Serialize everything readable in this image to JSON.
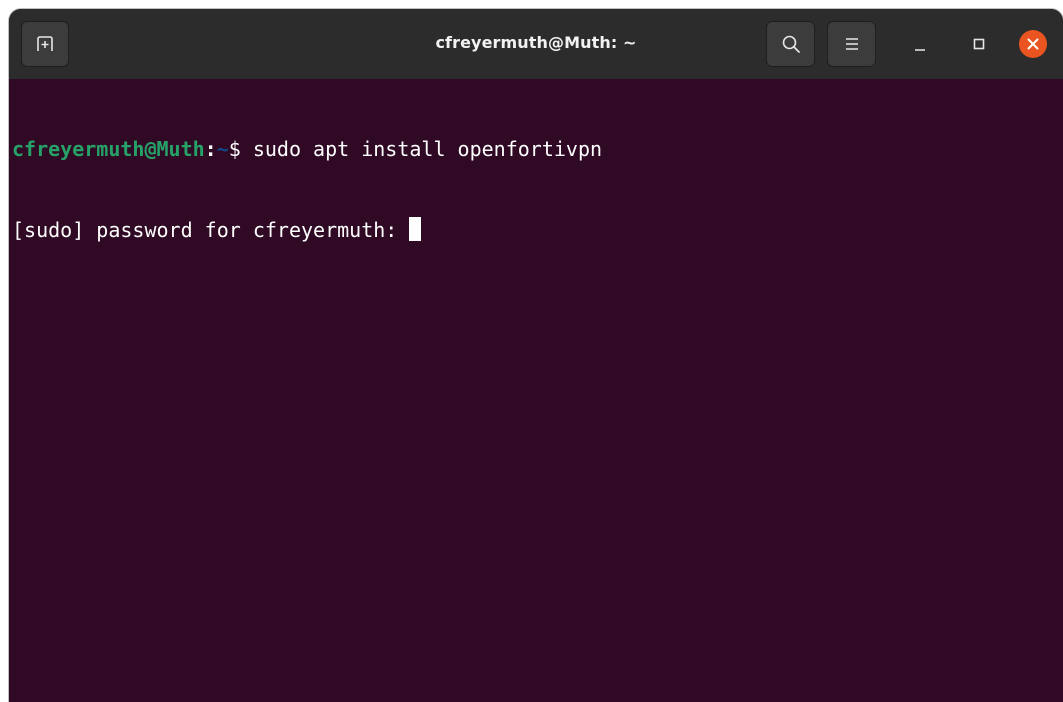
{
  "window": {
    "title": "cfreyermuth@Muth: ~",
    "accent_color": "#e95420",
    "background_color": "#300a24"
  },
  "titlebar": {
    "new_tab_icon": "new-tab-icon",
    "search_icon": "search-icon",
    "menu_icon": "hamburger-menu-icon",
    "minimize_icon": "minimize-icon",
    "maximize_icon": "maximize-icon",
    "close_icon": "close-icon"
  },
  "terminal": {
    "lines": [
      {
        "user_host": "cfreyermuth@Muth",
        "separator": ":",
        "path": "~",
        "prompt_symbol": "$ ",
        "command": "sudo apt install openfortivpn"
      },
      {
        "text": "[sudo] password for cfreyermuth: "
      }
    ],
    "colors": {
      "user_host": "#26a269",
      "path": "#12488b",
      "text": "#ffffff"
    }
  }
}
